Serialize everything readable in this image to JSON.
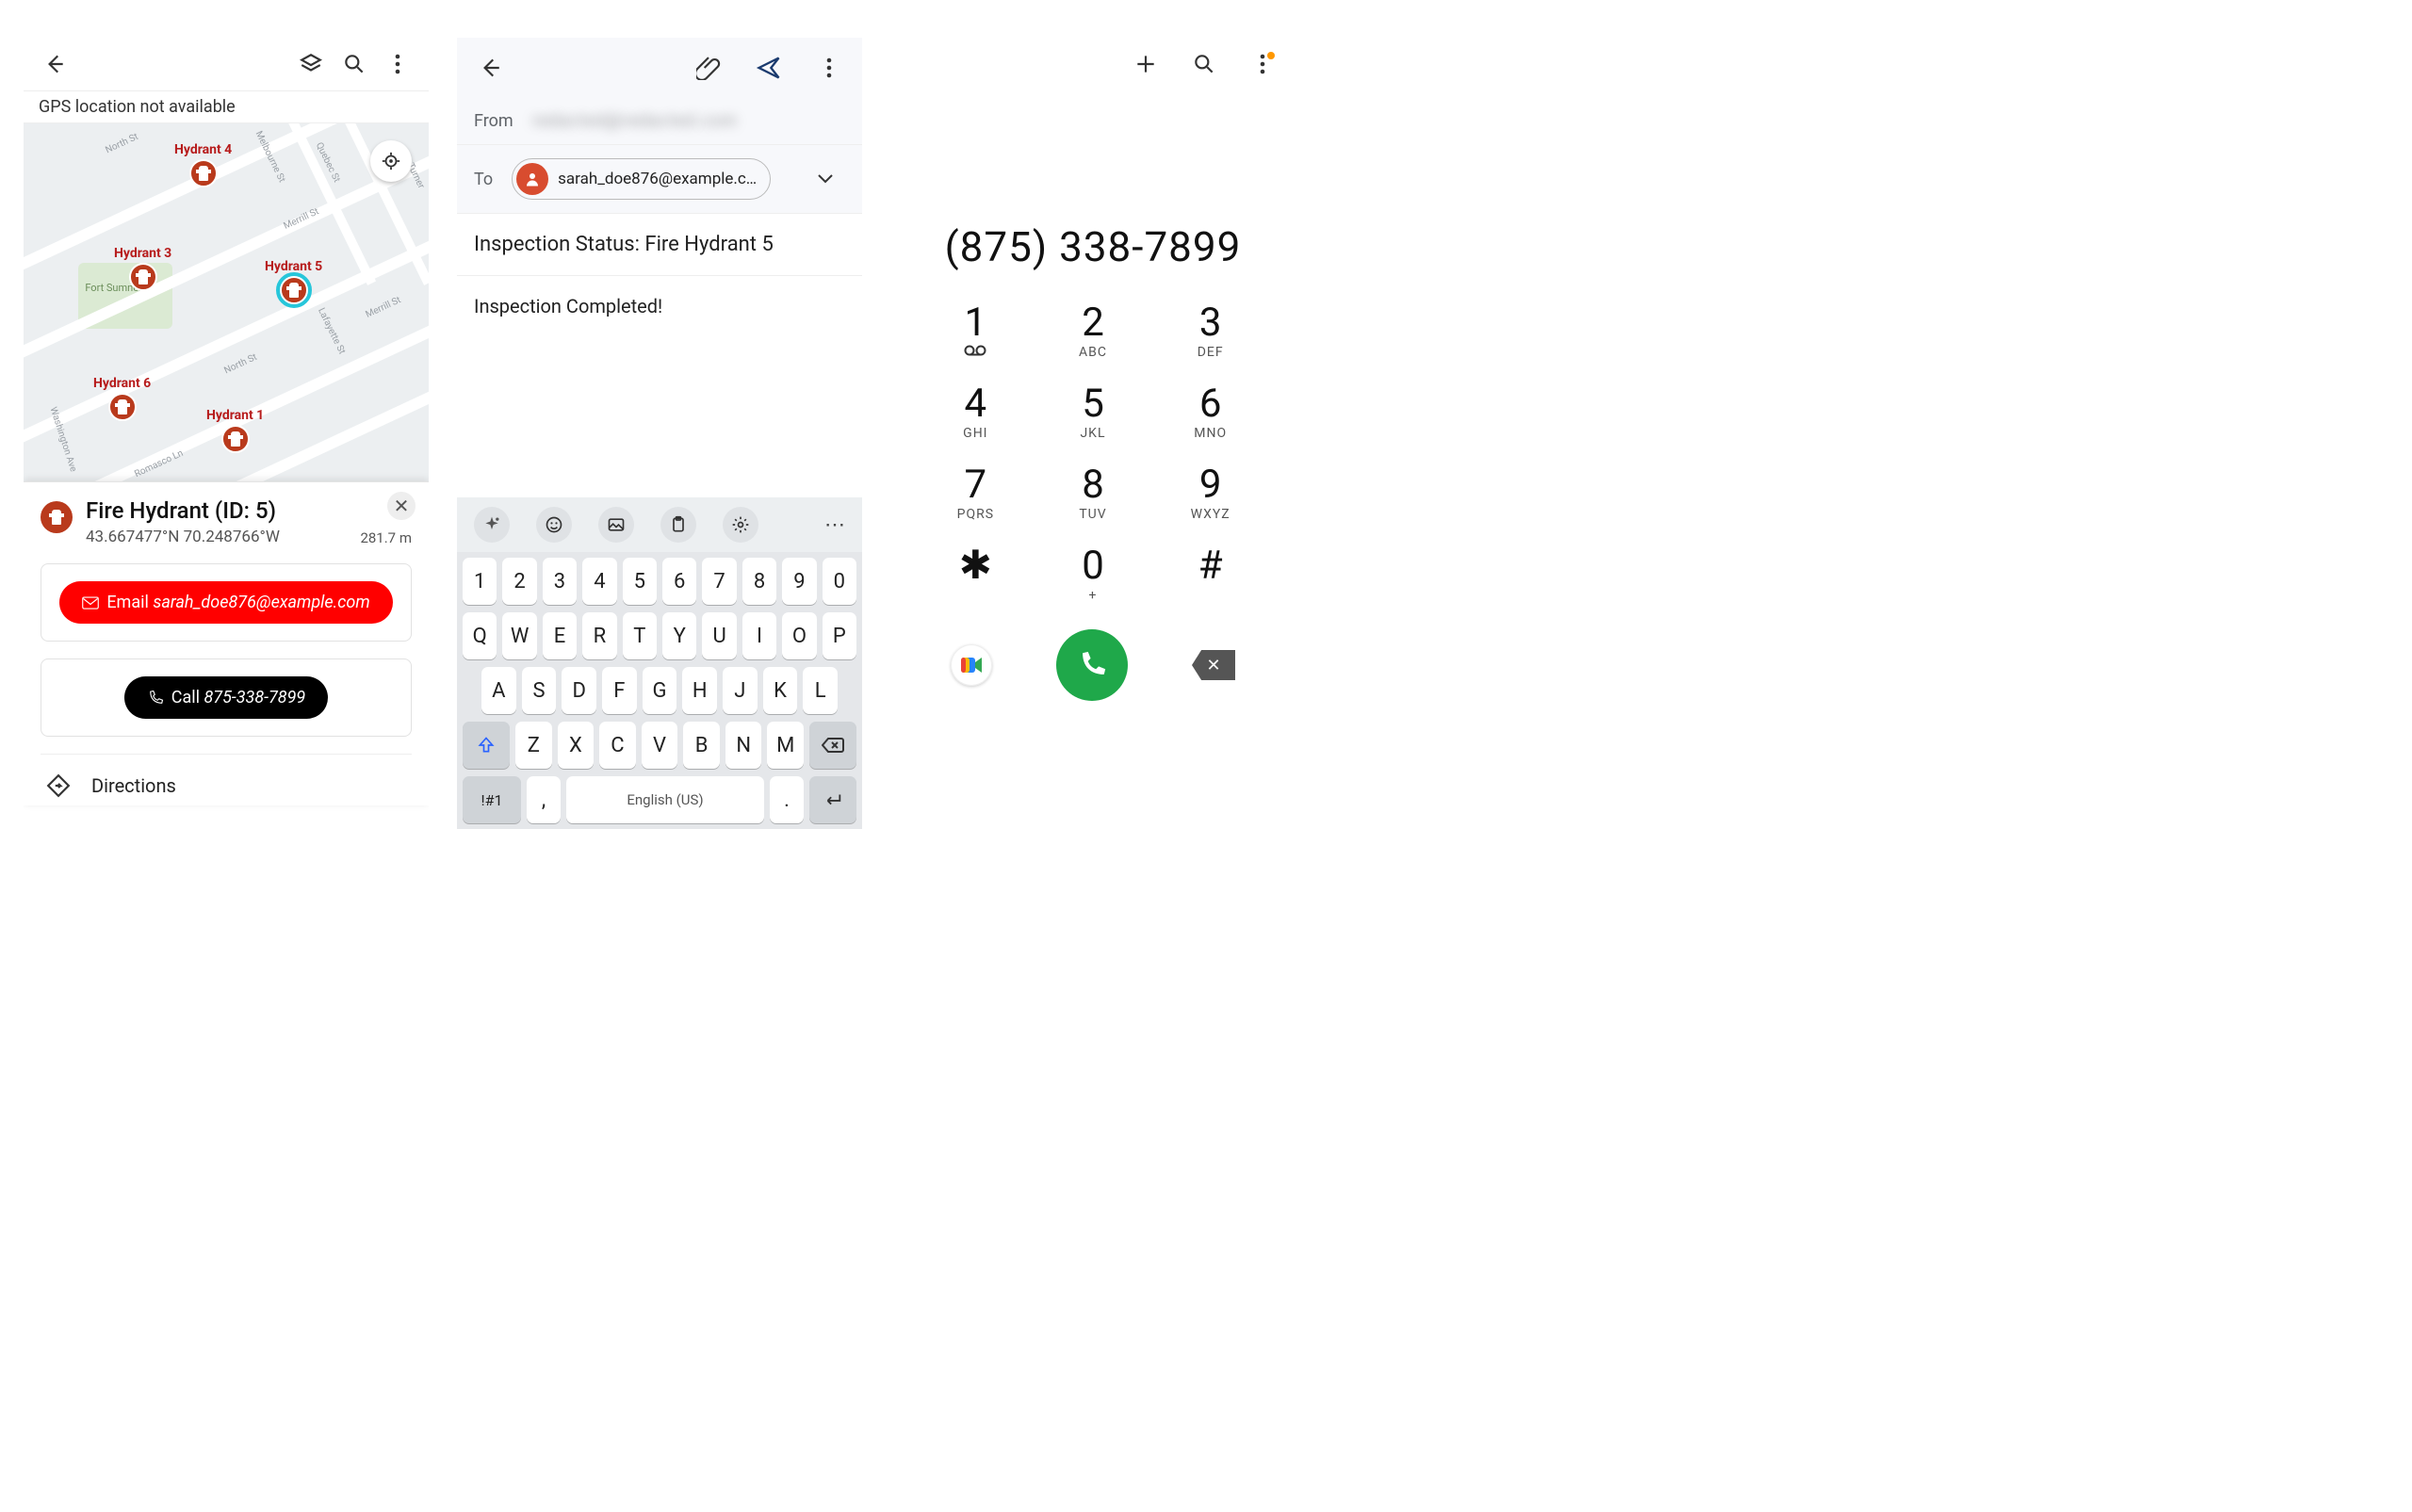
{
  "panelA": {
    "gpsBanner": "GPS location not available",
    "hydrants": [
      {
        "label": "Hydrant 4"
      },
      {
        "label": "Hydrant 3"
      },
      {
        "label": "Hydrant 5"
      },
      {
        "label": "Hydrant 6"
      },
      {
        "label": "Hydrant 1"
      }
    ],
    "parkLabel": "Fort Sumner Park",
    "streets": [
      "North St",
      "Melbourne St",
      "Quebec St",
      "Merrill St",
      "Merrill St",
      "Turner St",
      "Lafayette St",
      "North St",
      "Washington Ave",
      "Romasco Ln"
    ],
    "card": {
      "title": "Fire Hydrant (ID: 5)",
      "coords": "43.667477°N 70.248766°W",
      "distance": "281.7 m",
      "emailPrefix": "Email ",
      "email": "sarah_doe876@example.com",
      "callPrefix": "Call ",
      "phone": "875-338-7899",
      "directions": "Directions"
    }
  },
  "panelB": {
    "fromLabel": "From",
    "fromValue": "redacted@redacted.com",
    "toLabel": "To",
    "toChip": "sarah_doe876@example.c…",
    "subject": "Inspection Status: Fire Hydrant 5",
    "body": "Inspection Completed!",
    "keyboard": {
      "row0": [
        "1",
        "2",
        "3",
        "4",
        "5",
        "6",
        "7",
        "8",
        "9",
        "0"
      ],
      "row1": [
        "Q",
        "W",
        "E",
        "R",
        "T",
        "Y",
        "U",
        "I",
        "O",
        "P"
      ],
      "row2": [
        "A",
        "S",
        "D",
        "F",
        "G",
        "H",
        "J",
        "K",
        "L"
      ],
      "row3": [
        "Z",
        "X",
        "C",
        "V",
        "B",
        "N",
        "M"
      ],
      "switch": "!#1",
      "space": "English (US)",
      "comma": ",",
      "period": "."
    }
  },
  "panelC": {
    "number": "(875) 338-7899",
    "keys": [
      {
        "d": "1",
        "s": ""
      },
      {
        "d": "2",
        "s": "ABC"
      },
      {
        "d": "3",
        "s": "DEF"
      },
      {
        "d": "4",
        "s": "GHI"
      },
      {
        "d": "5",
        "s": "JKL"
      },
      {
        "d": "6",
        "s": "MNO"
      },
      {
        "d": "7",
        "s": "PQRS"
      },
      {
        "d": "8",
        "s": "TUV"
      },
      {
        "d": "9",
        "s": "WXYZ"
      },
      {
        "d": "✱",
        "s": ""
      },
      {
        "d": "0",
        "s": "+"
      },
      {
        "d": "#",
        "s": ""
      }
    ]
  }
}
